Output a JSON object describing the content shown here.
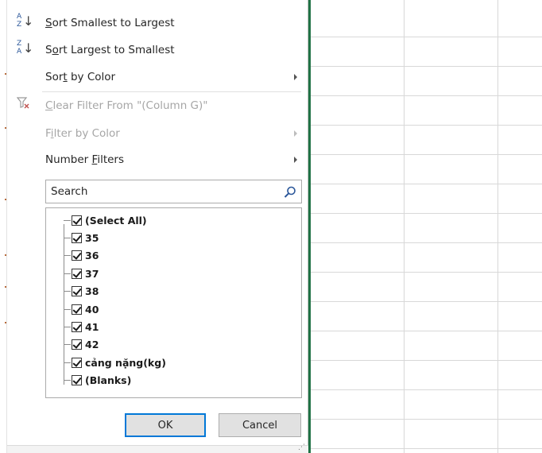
{
  "menu": {
    "sort_asc_pre": "",
    "sort_asc_key": "S",
    "sort_asc_post": "ort Smallest to Largest",
    "sort_desc_pre": "S",
    "sort_desc_key": "o",
    "sort_desc_post": "rt Largest to Smallest",
    "sort_color_pre": "Sor",
    "sort_color_key": "t",
    "sort_color_post": " by Color",
    "clear_pre": "",
    "clear_key": "C",
    "clear_post": "lear Filter From \"(Column G)\"",
    "filter_color_pre": "F",
    "filter_color_key": "i",
    "filter_color_post": "lter by Color",
    "number_pre": "Number ",
    "number_key": "F",
    "number_post": "ilters",
    "sort_asc_icon_top": "A",
    "sort_asc_icon_bottom": "Z",
    "sort_desc_icon_top": "Z",
    "sort_desc_icon_bottom": "A",
    "arrow_glyph": "↓"
  },
  "search": {
    "placeholder": "Search",
    "icon": "search-icon"
  },
  "filter_list": {
    "items": [
      {
        "label": "(Select All)",
        "checked": true
      },
      {
        "label": "35",
        "checked": true
      },
      {
        "label": "36",
        "checked": true
      },
      {
        "label": "37",
        "checked": true
      },
      {
        "label": "38",
        "checked": true
      },
      {
        "label": "40",
        "checked": true
      },
      {
        "label": "41",
        "checked": true
      },
      {
        "label": "42",
        "checked": true
      },
      {
        "label": "cảng nặng(kg)",
        "checked": true
      },
      {
        "label": "(Blanks)",
        "checked": true
      }
    ]
  },
  "buttons": {
    "ok": "OK",
    "cancel": "Cancel"
  },
  "colors": {
    "selected_column_border": "#217346",
    "ok_focus": "#0078d7"
  }
}
